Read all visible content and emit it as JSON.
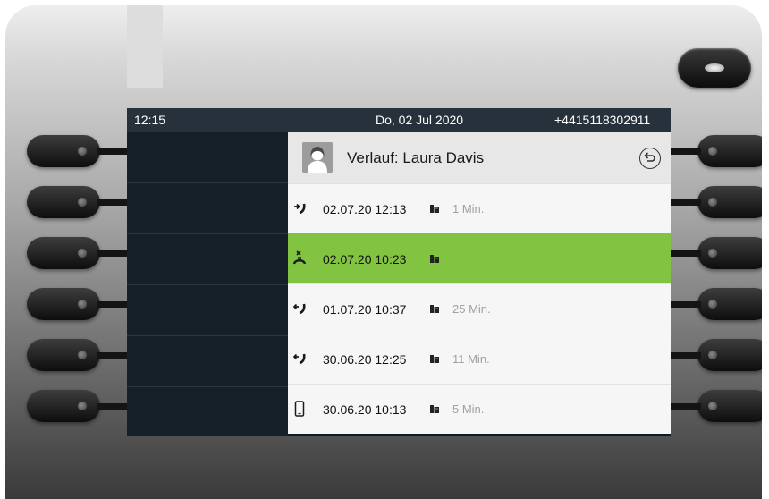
{
  "status_bar": {
    "time": "12:15",
    "date": "Do, 02 Jul 2020",
    "number": "+4415118302911"
  },
  "header": {
    "title": "Verlauf: Laura Davis",
    "avatar_icon": "person-avatar-icon",
    "back_icon": "back-arrow-icon"
  },
  "calls": [
    {
      "type": "outgoing-call-icon",
      "datetime": "02.07.20 12:13",
      "location": "building-icon",
      "duration": "1 Min."
    },
    {
      "type": "missed-call-icon",
      "datetime": "02.07.20 10:23",
      "location": "building-icon",
      "duration": "",
      "selected": true
    },
    {
      "type": "incoming-call-icon",
      "datetime": "01.07.20 10:37",
      "location": "building-icon",
      "duration": "25 Min."
    },
    {
      "type": "incoming-call-icon",
      "datetime": "30.06.20 12:25",
      "location": "building-icon",
      "duration": "11 Min."
    },
    {
      "type": "mobile-phone-icon",
      "datetime": "30.06.20 10:13",
      "location": "building-icon",
      "duration": "5 Min."
    }
  ],
  "colors": {
    "selected_row": "#82c341",
    "screen_background": "#101820",
    "status_bar": "#27313b",
    "header_background": "#e7e7e7"
  }
}
